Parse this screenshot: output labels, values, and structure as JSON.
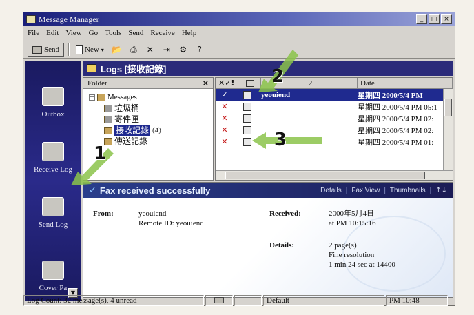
{
  "window": {
    "title": "Message Manager"
  },
  "menu": [
    "File",
    "Edit",
    "View",
    "Go",
    "Tools",
    "Send",
    "Receive",
    "Help"
  ],
  "toolbar": {
    "send_label": "Send",
    "new_label": "New"
  },
  "nav": [
    "Outbox",
    "Receive Log",
    "Send Log",
    "Cover Pa"
  ],
  "logs_header": "Logs [接收記錄]",
  "folder": {
    "header": "Folder",
    "root": "Messages",
    "children": [
      {
        "label": "垃圾桶"
      },
      {
        "label": "寄件匣"
      },
      {
        "label": "接收記錄",
        "count": "(4)"
      },
      {
        "label": "傳送記錄"
      }
    ]
  },
  "list": {
    "header_icons": "✕✓!",
    "header_date": "Date",
    "header_mid": "2",
    "rows": [
      {
        "status": "✓",
        "from": "yeouiend",
        "date": "星期四 2000/5/4 PM"
      },
      {
        "status": "✕",
        "from": "",
        "date": "星期四 2000/5/4 PM 05:1"
      },
      {
        "status": "✕",
        "from": "",
        "date": "星期四 2000/5/4 PM 02:"
      },
      {
        "status": "✕",
        "from": "",
        "date": "星期四 2000/5/4 PM 02:"
      },
      {
        "status": "✕",
        "from": "",
        "date": "星期四 2000/5/4 PM 01:"
      }
    ]
  },
  "preview": {
    "title": "Fax received successfully",
    "tabs": [
      "Details",
      "Fax View",
      "Thumbnails"
    ],
    "from_label": "From:",
    "from_value": "yeouiend",
    "remote_id": "Remote ID: yeouiend",
    "received_label": "Received:",
    "received_value_1": "2000年5月4日",
    "received_value_2": "at PM 10:15:16",
    "details_label": "Details:",
    "details_1": "2 page(s)",
    "details_2": "Fine resolution",
    "details_3": "1 min 24 sec at 14400"
  },
  "status": {
    "left": "Log Count: 32 message(s), 4 unread",
    "middle": "Default",
    "time": "PM 10:48"
  },
  "callouts": [
    "1",
    "2",
    "3"
  ],
  "colors": {
    "nav_bg": "#2a2a8a",
    "arrow": "#8bc34a",
    "selection": "#1f2a8f",
    "error_x": "#c61d1d"
  }
}
